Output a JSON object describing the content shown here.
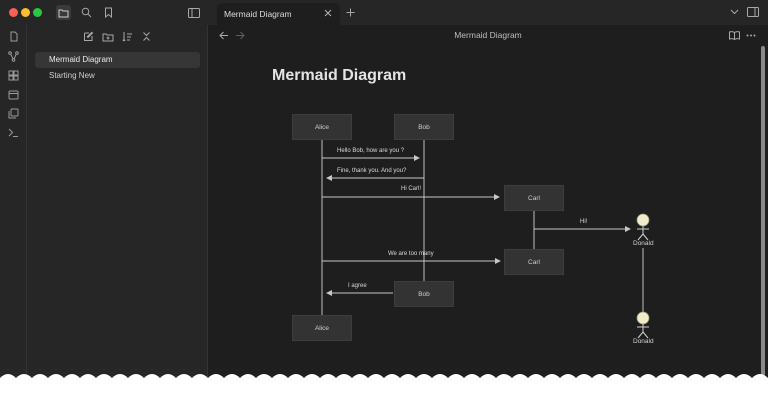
{
  "window": {
    "traffic_lights": {
      "close": "#fe5f57",
      "minimize": "#febc2e",
      "zoom": "#28c840"
    }
  },
  "toolbar": {
    "icons": [
      "folder-icon",
      "search-icon",
      "bookmark-icon",
      "sidebar-toggle-icon"
    ]
  },
  "ribbon": {
    "icons": [
      "pages-icon",
      "graph-icon",
      "canvas-icon",
      "calendar-icon",
      "copy-icon",
      "terminal-icon"
    ]
  },
  "file_actions": [
    "new-note-icon",
    "new-folder-icon",
    "sort-icon",
    "collapse-icon"
  ],
  "files": [
    {
      "label": "Mermaid Diagram",
      "active": true
    },
    {
      "label": "Starting New",
      "active": false
    }
  ],
  "tab": {
    "title": "Mermaid Diagram",
    "close_icon": "×",
    "new_icon": "+"
  },
  "view": {
    "title": "Mermaid Diagram"
  },
  "note": {
    "title": "Mermaid Diagram"
  },
  "diagram": {
    "actors": {
      "alice": "Alice",
      "bob": "Bob",
      "carl": "Carl",
      "donald": "Donald"
    },
    "messages": {
      "m1": "Hello Bob, how are you ?",
      "m2": "Fine, thank you. And you?",
      "m3": "Hi Carl!",
      "m4": "Hi!",
      "m5": "We are too many",
      "m6": "I agree"
    }
  },
  "colors": {
    "background": "#1e1e1e",
    "panel": "#262626",
    "actor_box": "#333333",
    "stick_head": "#f1ecc8",
    "line": "#c8c8c8"
  }
}
